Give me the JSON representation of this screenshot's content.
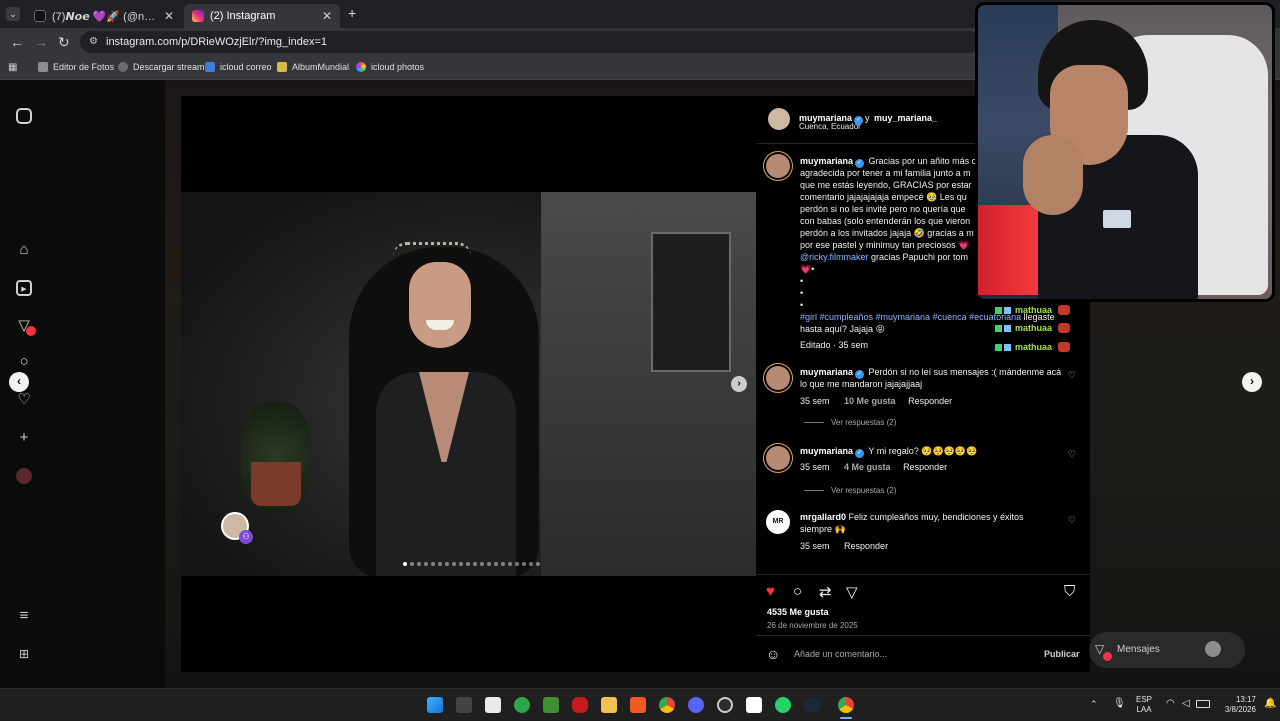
{
  "browser": {
    "tabs": [
      {
        "label": "(7)𝙉𝙤𝙚 💜🚀 (@noe_mik) | Ti..."
      },
      {
        "label": "(2) Instagram"
      }
    ],
    "new_tab": "+",
    "url": "instagram.com/p/DRieWOzjElr/?img_index=1",
    "bookmarks": [
      "Editor de Fotos",
      "Descargar stream",
      "icloud correo",
      "AlbumMundial",
      "icloud photos"
    ]
  },
  "post": {
    "header_user": "muymariana",
    "header_and": "y",
    "header_user2": "muy_mariana_",
    "location": "Cuenca, Ecuador",
    "caption_user": "muymariana",
    "caption_lines": [
      "Gracias por un añito más c",
      "agradecida por tener a mi familia junto a m",
      "que me estás leyendo, GRACIAS por estar",
      "comentario jajajajajaja empecé 🥹 Les qu",
      "perdón si no les invité pero no quería que",
      "con babas (solo entenderán los que vieron",
      "perdón a los invitados jajaja 🤣 gracias a m",
      "por ese pastel y minimuy tan preciosos 💗",
      "gracias Papuchi por tom",
      "💗•",
      "•",
      "•",
      "•"
    ],
    "mention": "@ricky.filmmaker",
    "hashtags": "#girl #cumpleaños #muymariana #cuenca #ecuatoriana",
    "caption_end_1": "llegaste",
    "caption_end_2": "hasta aquí? Jajaja 😝",
    "edited": "Editado · 35 sem",
    "comments": [
      {
        "user": "muymariana",
        "verified": true,
        "text1": "Perdón si no leí sus mensajes :( mándenme acá",
        "text2": "lo que me mandaron jajajajjaaj",
        "time": "35 sem",
        "likes": "10 Me gusta",
        "reply": "Responder",
        "replies": "Ver respuestas (2)"
      },
      {
        "user": "muymariana",
        "verified": true,
        "text1": "Y mi regalo? 🥺🥺🥺🥺🥺",
        "text2": "",
        "time": "35 sem",
        "likes": "4 Me gusta",
        "reply": "Responder",
        "replies": "Ver respuestas (2)"
      },
      {
        "user": "mrgallard0",
        "verified": false,
        "text1": "Feliz cumpleaños muy, bendiciones y éxitos",
        "text2": "siempre 🙌",
        "time": "35 sem",
        "likes": "",
        "reply": "Responder",
        "replies": ""
      }
    ],
    "likes": "4535 Me gusta",
    "date": "26 de noviembre de 2025",
    "comment_placeholder": "Añade un comentario...",
    "publish": "Publicar",
    "total_slides": 20,
    "current_slide": 1
  },
  "messages_label": "Mensajes",
  "chat_overlay": [
    {
      "user": "mathuaa"
    },
    {
      "user": "mathuaa"
    },
    {
      "user": "mathuaa"
    },
    {
      "user": "mathuaa"
    }
  ],
  "tray": {
    "lang1": "ESP",
    "lang2": "LAA",
    "time": "13:17",
    "date": "3/8/2026"
  }
}
